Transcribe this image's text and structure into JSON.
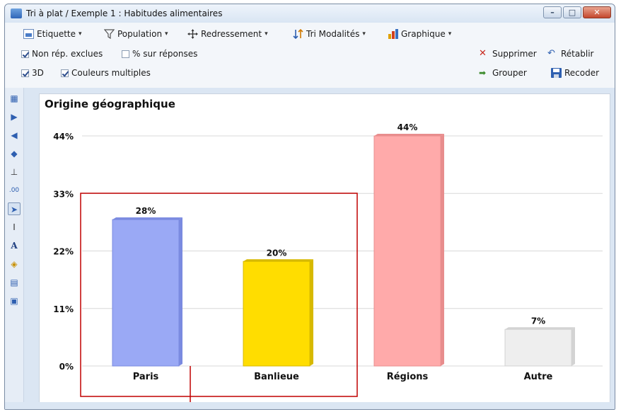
{
  "window": {
    "title": "Tri à plat / Exemple 1 : Habitudes alimentaires",
    "controls": {
      "minimize": "–",
      "maximize": "□",
      "close": "✕"
    }
  },
  "toolbar": {
    "menus": [
      {
        "label": "Etiquette",
        "icon": "label-icon"
      },
      {
        "label": "Population",
        "icon": "filter-icon"
      },
      {
        "label": "Redressement",
        "icon": "move-icon"
      },
      {
        "label": "Tri Modalités",
        "icon": "sort-icon"
      },
      {
        "label": "Graphique",
        "icon": "bar-chart-icon"
      }
    ],
    "options": [
      {
        "label": "Non rép. exclues",
        "checked": true
      },
      {
        "label": "% sur réponses",
        "checked": false
      },
      {
        "label": "3D",
        "checked": true
      },
      {
        "label": "Couleurs multiples",
        "checked": true
      }
    ],
    "actions": [
      {
        "label": "Supprimer",
        "icon": "delete-icon"
      },
      {
        "label": "Rétablir",
        "icon": "undo-icon"
      },
      {
        "label": "Grouper",
        "icon": "arrow-right-icon"
      },
      {
        "label": "Recoder",
        "icon": "save-icon"
      }
    ]
  },
  "sidebar": {
    "tools": [
      "table-icon",
      "play-right-icon",
      "play-left-icon",
      "expand-horizontal-icon",
      "axis-icon",
      "decimal-icon",
      "pointer-icon",
      "text-cursor-icon",
      "font-icon",
      "paint-bucket-icon",
      "layout-icon",
      "window-icon"
    ],
    "selected": "pointer-icon"
  },
  "chart_data": {
    "type": "bar",
    "title": "Origine géographique",
    "categories": [
      "Paris",
      "Banlieue",
      "Régions",
      "Autre"
    ],
    "values": [
      28,
      20,
      44,
      7
    ],
    "value_labels": [
      "28%",
      "20%",
      "44%",
      "7%"
    ],
    "yticks": [
      "0%",
      "11%",
      "22%",
      "33%",
      "44%"
    ],
    "ytick_values": [
      0,
      11,
      22,
      33,
      44
    ],
    "ylim": [
      0,
      44
    ],
    "grid": true,
    "three_d": true,
    "colors": [
      "#9aa9f5",
      "#ffdd00",
      "#ffaaaa",
      "#eeeeee"
    ],
    "side_colors": [
      "#7a8ae0",
      "#d7b900",
      "#e88d8d",
      "#d3d3d3"
    ],
    "highlight_color": "#c00000"
  }
}
